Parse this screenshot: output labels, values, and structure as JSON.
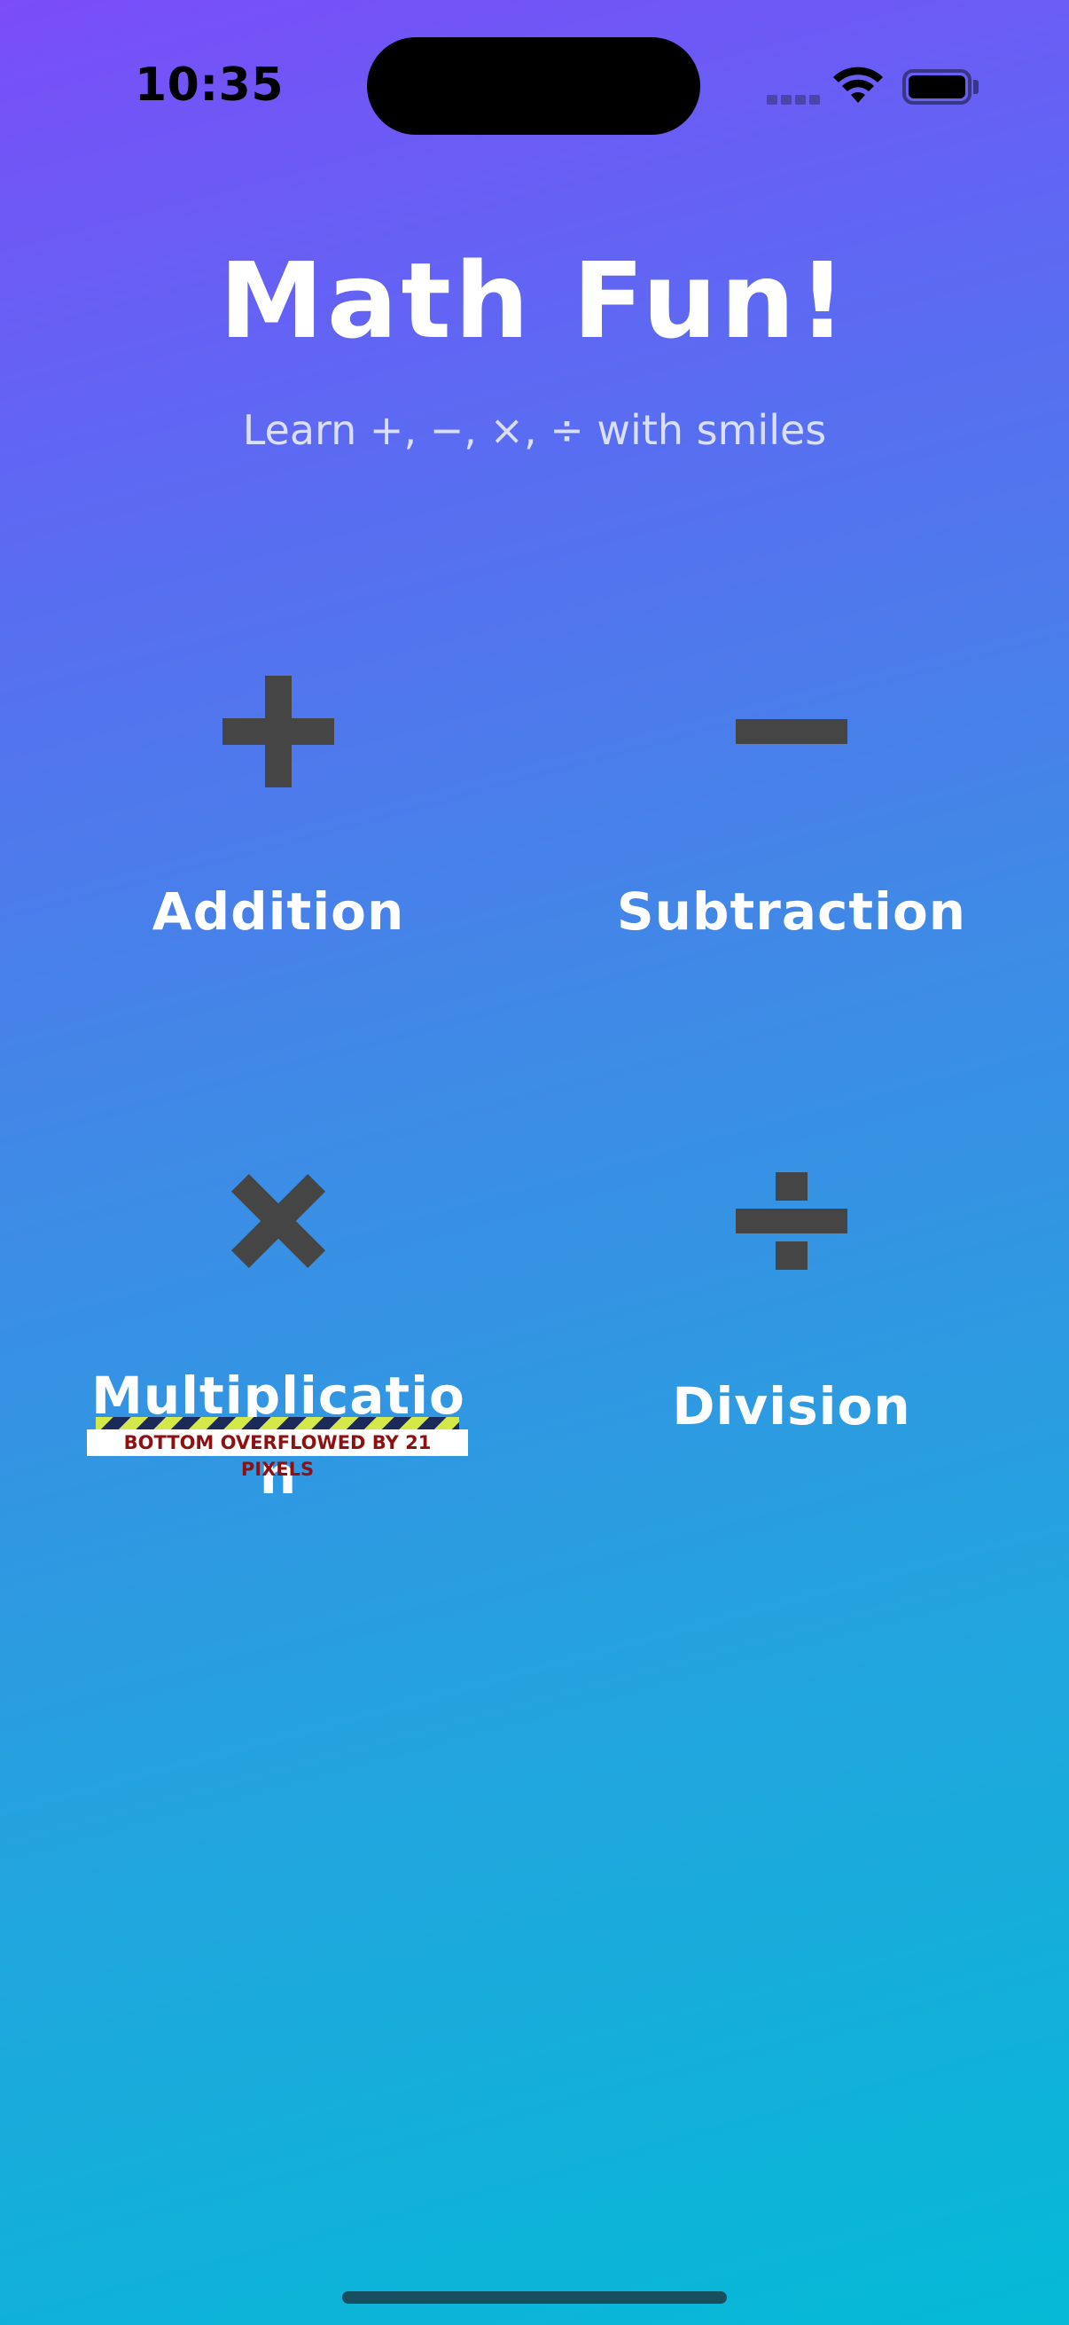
{
  "status_bar": {
    "time": "10:35"
  },
  "header": {
    "title": "Math Fun!",
    "subtitle": "Learn +, −, ×, ÷ with smiles"
  },
  "operations": [
    {
      "label": "Addition",
      "icon": "plus-icon"
    },
    {
      "label": "Subtraction",
      "icon": "minus-icon"
    },
    {
      "label": "Multiplicatio",
      "label_wrap": "n",
      "icon": "times-icon"
    },
    {
      "label": "Division",
      "icon": "divide-icon"
    }
  ],
  "overflow_warning": "BOTTOM OVERFLOWED BY 21 PIXELS",
  "colors": {
    "gradient_top": "#7a4df8",
    "gradient_bottom": "#05bad6",
    "icon": "#454545",
    "text": "#ffffff"
  }
}
